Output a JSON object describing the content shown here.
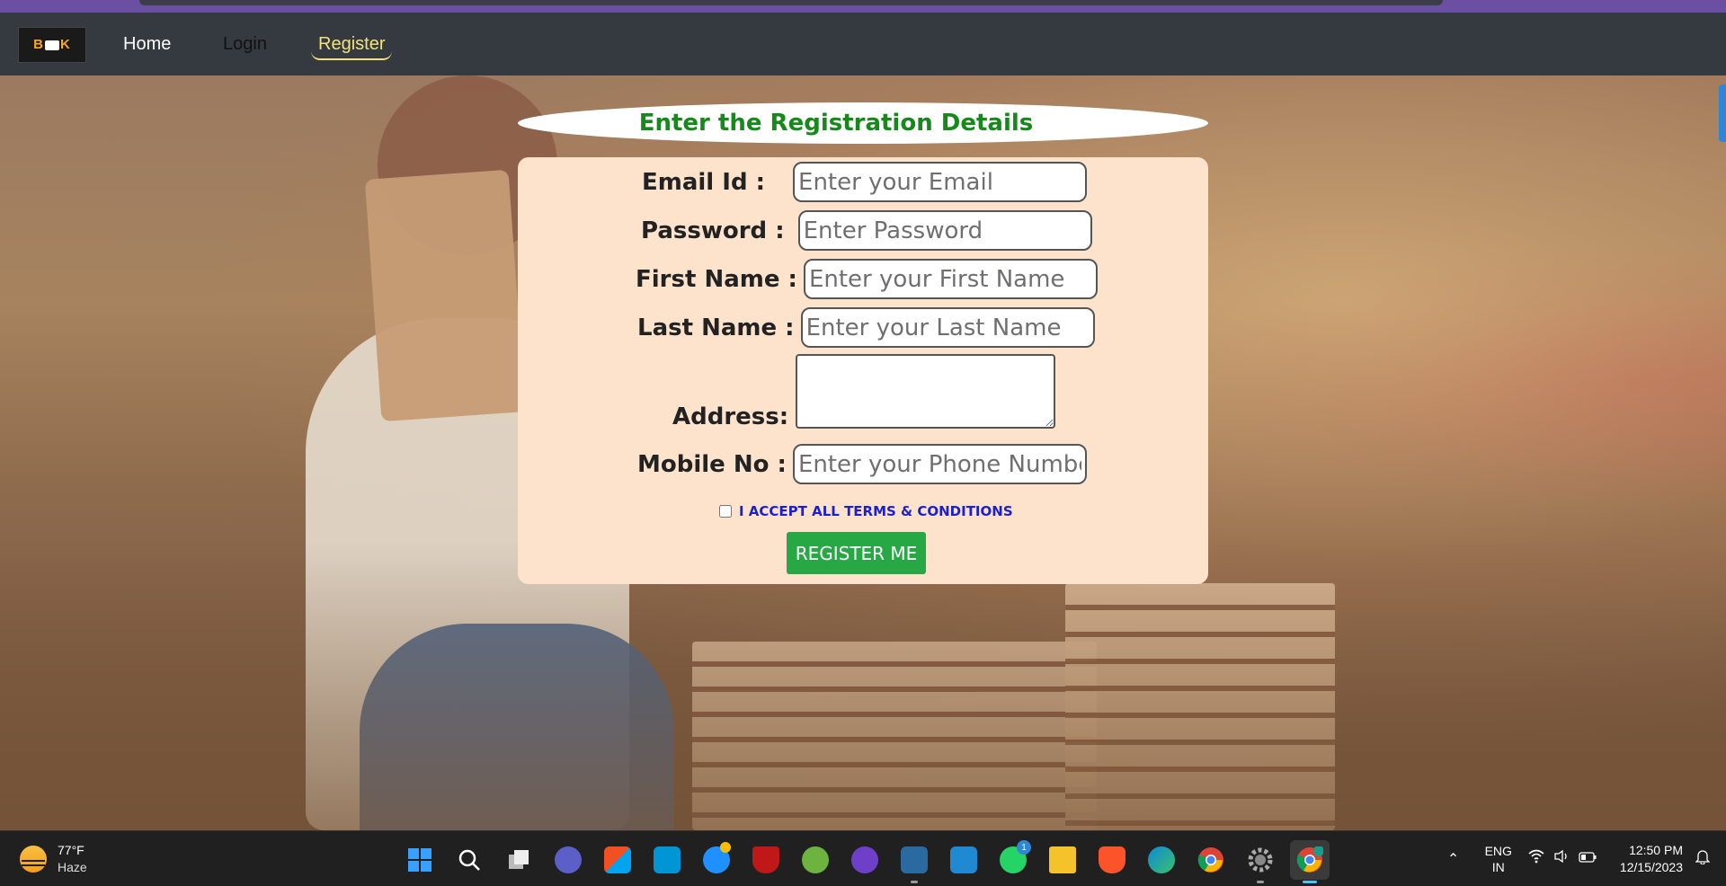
{
  "navbar": {
    "logo_text": "BOOK",
    "links": [
      {
        "label": "Home"
      },
      {
        "label": "Login"
      },
      {
        "label": "Register",
        "active": true
      }
    ],
    "active_color": "#f4e27a"
  },
  "form": {
    "title": "Enter the Registration Details",
    "title_color": "#158a1a",
    "card_color": "#fde3cc",
    "fields": [
      {
        "label": "Email Id :",
        "placeholder": "Enter your Email",
        "value": ""
      },
      {
        "label": "Password :",
        "placeholder": "Enter Password",
        "value": ""
      },
      {
        "label": "First Name :",
        "placeholder": "Enter your First Name",
        "value": ""
      },
      {
        "label": "Last Name :",
        "placeholder": "Enter your Last Name",
        "value": ""
      },
      {
        "label": "Address:",
        "placeholder": "",
        "value": ""
      },
      {
        "label": "Mobile No :",
        "placeholder": "Enter your Phone Number",
        "value": ""
      }
    ],
    "terms_label": "I ACCEPT ALL TERMS & CONDITIONS",
    "terms_checked": false,
    "submit_label": "REGISTER ME",
    "submit_color": "#28a745"
  },
  "taskbar": {
    "weather": {
      "temp": "77°F",
      "condition": "Haze"
    },
    "apps": [
      {
        "name": "windows-start-icon"
      },
      {
        "name": "search-icon"
      },
      {
        "name": "task-view-icon"
      },
      {
        "name": "meet-icon"
      },
      {
        "name": "store-icon"
      },
      {
        "name": "myhp-icon"
      },
      {
        "name": "help-icon"
      },
      {
        "name": "mcafee-icon"
      },
      {
        "name": "spring-icon"
      },
      {
        "name": "github-icon"
      },
      {
        "name": "mysql-icon"
      },
      {
        "name": "vscode-icon"
      },
      {
        "name": "whatsapp-icon",
        "badge": "1"
      },
      {
        "name": "file-explorer-icon"
      },
      {
        "name": "brave-icon"
      },
      {
        "name": "edge-icon"
      },
      {
        "name": "chrome-icon"
      },
      {
        "name": "settings-icon"
      },
      {
        "name": "chrome-profile-icon"
      }
    ],
    "tray": {
      "lang_line1": "ENG",
      "lang_line2": "IN",
      "time": "12:50 PM",
      "date": "12/15/2023"
    }
  }
}
